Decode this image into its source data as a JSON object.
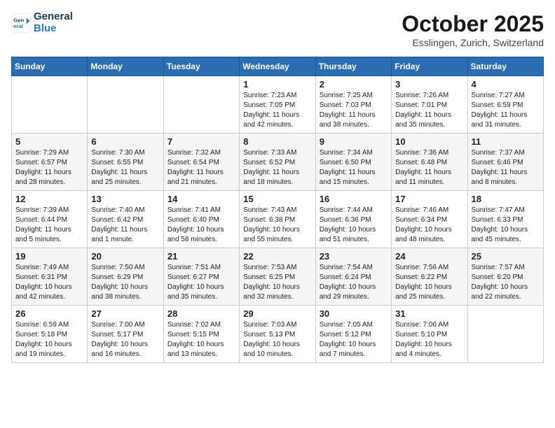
{
  "header": {
    "logo_line1": "General",
    "logo_line2": "Blue",
    "month": "October 2025",
    "location": "Esslingen, Zurich, Switzerland"
  },
  "weekdays": [
    "Sunday",
    "Monday",
    "Tuesday",
    "Wednesday",
    "Thursday",
    "Friday",
    "Saturday"
  ],
  "weeks": [
    [
      {
        "day": "",
        "info": ""
      },
      {
        "day": "",
        "info": ""
      },
      {
        "day": "",
        "info": ""
      },
      {
        "day": "1",
        "info": "Sunrise: 7:23 AM\nSunset: 7:05 PM\nDaylight: 11 hours\nand 42 minutes."
      },
      {
        "day": "2",
        "info": "Sunrise: 7:25 AM\nSunset: 7:03 PM\nDaylight: 11 hours\nand 38 minutes."
      },
      {
        "day": "3",
        "info": "Sunrise: 7:26 AM\nSunset: 7:01 PM\nDaylight: 11 hours\nand 35 minutes."
      },
      {
        "day": "4",
        "info": "Sunrise: 7:27 AM\nSunset: 6:59 PM\nDaylight: 11 hours\nand 31 minutes."
      }
    ],
    [
      {
        "day": "5",
        "info": "Sunrise: 7:29 AM\nSunset: 6:57 PM\nDaylight: 11 hours\nand 28 minutes."
      },
      {
        "day": "6",
        "info": "Sunrise: 7:30 AM\nSunset: 6:55 PM\nDaylight: 11 hours\nand 25 minutes."
      },
      {
        "day": "7",
        "info": "Sunrise: 7:32 AM\nSunset: 6:54 PM\nDaylight: 11 hours\nand 21 minutes."
      },
      {
        "day": "8",
        "info": "Sunrise: 7:33 AM\nSunset: 6:52 PM\nDaylight: 11 hours\nand 18 minutes."
      },
      {
        "day": "9",
        "info": "Sunrise: 7:34 AM\nSunset: 6:50 PM\nDaylight: 11 hours\nand 15 minutes."
      },
      {
        "day": "10",
        "info": "Sunrise: 7:36 AM\nSunset: 6:48 PM\nDaylight: 11 hours\nand 11 minutes."
      },
      {
        "day": "11",
        "info": "Sunrise: 7:37 AM\nSunset: 6:46 PM\nDaylight: 11 hours\nand 8 minutes."
      }
    ],
    [
      {
        "day": "12",
        "info": "Sunrise: 7:39 AM\nSunset: 6:44 PM\nDaylight: 11 hours\nand 5 minutes."
      },
      {
        "day": "13",
        "info": "Sunrise: 7:40 AM\nSunset: 6:42 PM\nDaylight: 11 hours\nand 1 minute."
      },
      {
        "day": "14",
        "info": "Sunrise: 7:41 AM\nSunset: 6:40 PM\nDaylight: 10 hours\nand 58 minutes."
      },
      {
        "day": "15",
        "info": "Sunrise: 7:43 AM\nSunset: 6:38 PM\nDaylight: 10 hours\nand 55 minutes."
      },
      {
        "day": "16",
        "info": "Sunrise: 7:44 AM\nSunset: 6:36 PM\nDaylight: 10 hours\nand 51 minutes."
      },
      {
        "day": "17",
        "info": "Sunrise: 7:46 AM\nSunset: 6:34 PM\nDaylight: 10 hours\nand 48 minutes."
      },
      {
        "day": "18",
        "info": "Sunrise: 7:47 AM\nSunset: 6:33 PM\nDaylight: 10 hours\nand 45 minutes."
      }
    ],
    [
      {
        "day": "19",
        "info": "Sunrise: 7:49 AM\nSunset: 6:31 PM\nDaylight: 10 hours\nand 42 minutes."
      },
      {
        "day": "20",
        "info": "Sunrise: 7:50 AM\nSunset: 6:29 PM\nDaylight: 10 hours\nand 38 minutes."
      },
      {
        "day": "21",
        "info": "Sunrise: 7:51 AM\nSunset: 6:27 PM\nDaylight: 10 hours\nand 35 minutes."
      },
      {
        "day": "22",
        "info": "Sunrise: 7:53 AM\nSunset: 6:25 PM\nDaylight: 10 hours\nand 32 minutes."
      },
      {
        "day": "23",
        "info": "Sunrise: 7:54 AM\nSunset: 6:24 PM\nDaylight: 10 hours\nand 29 minutes."
      },
      {
        "day": "24",
        "info": "Sunrise: 7:56 AM\nSunset: 6:22 PM\nDaylight: 10 hours\nand 25 minutes."
      },
      {
        "day": "25",
        "info": "Sunrise: 7:57 AM\nSunset: 6:20 PM\nDaylight: 10 hours\nand 22 minutes."
      }
    ],
    [
      {
        "day": "26",
        "info": "Sunrise: 6:59 AM\nSunset: 5:18 PM\nDaylight: 10 hours\nand 19 minutes."
      },
      {
        "day": "27",
        "info": "Sunrise: 7:00 AM\nSunset: 5:17 PM\nDaylight: 10 hours\nand 16 minutes."
      },
      {
        "day": "28",
        "info": "Sunrise: 7:02 AM\nSunset: 5:15 PM\nDaylight: 10 hours\nand 13 minutes."
      },
      {
        "day": "29",
        "info": "Sunrise: 7:03 AM\nSunset: 5:13 PM\nDaylight: 10 hours\nand 10 minutes."
      },
      {
        "day": "30",
        "info": "Sunrise: 7:05 AM\nSunset: 5:12 PM\nDaylight: 10 hours\nand 7 minutes."
      },
      {
        "day": "31",
        "info": "Sunrise: 7:06 AM\nSunset: 5:10 PM\nDaylight: 10 hours\nand 4 minutes."
      },
      {
        "day": "",
        "info": ""
      }
    ]
  ]
}
